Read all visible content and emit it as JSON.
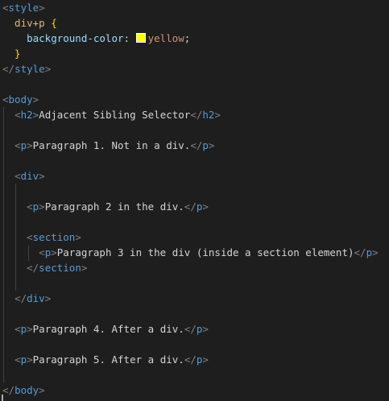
{
  "editor": {
    "theme_colors": {
      "background": "#1e1e1e",
      "tag": "#569cd6",
      "bracket": "#808080",
      "selector": "#d7ba7d",
      "brace": "#ffd700",
      "property": "#9cdcfe",
      "value": "#ce9178",
      "text": "#d4d4d4",
      "swatch": "#ffff00"
    },
    "lines": [
      {
        "tokens": [
          {
            "t": "<",
            "c": "c-punct"
          },
          {
            "t": "style",
            "c": "c-tag"
          },
          {
            "t": ">",
            "c": "c-punct"
          }
        ]
      },
      {
        "tokens": [
          {
            "t": "  div+p ",
            "c": "c-sel"
          },
          {
            "t": "{",
            "c": "c-brace"
          }
        ]
      },
      {
        "tokens": [
          {
            "t": "    background-color",
            "c": "c-prop"
          },
          {
            "t": ": ",
            "c": "c-text"
          },
          {
            "swatch": "#ffff00"
          },
          {
            "t": "yellow",
            "c": "c-val"
          },
          {
            "t": ";",
            "c": "c-text"
          }
        ]
      },
      {
        "tokens": [
          {
            "t": "  }",
            "c": "c-brace"
          }
        ]
      },
      {
        "tokens": [
          {
            "t": "</",
            "c": "c-punct"
          },
          {
            "t": "style",
            "c": "c-tag"
          },
          {
            "t": ">",
            "c": "c-punct"
          }
        ]
      },
      {
        "tokens": []
      },
      {
        "tokens": [
          {
            "t": "<",
            "c": "c-punct"
          },
          {
            "t": "body",
            "c": "c-tag"
          },
          {
            "t": ">",
            "c": "c-punct"
          }
        ]
      },
      {
        "tokens": [
          {
            "t": "  ",
            "c": "c-text"
          },
          {
            "t": "<",
            "c": "c-punct"
          },
          {
            "t": "h2",
            "c": "c-tag"
          },
          {
            "t": ">",
            "c": "c-punct"
          },
          {
            "t": "Adjacent Sibling Selector",
            "c": "c-text"
          },
          {
            "t": "</",
            "c": "c-punct"
          },
          {
            "t": "h2",
            "c": "c-tag"
          },
          {
            "t": ">",
            "c": "c-punct"
          }
        ]
      },
      {
        "tokens": []
      },
      {
        "tokens": [
          {
            "t": "  ",
            "c": "c-text"
          },
          {
            "t": "<",
            "c": "c-punct"
          },
          {
            "t": "p",
            "c": "c-tag"
          },
          {
            "t": ">",
            "c": "c-punct"
          },
          {
            "t": "Paragraph 1. Not in a div.",
            "c": "c-text"
          },
          {
            "t": "</",
            "c": "c-punct"
          },
          {
            "t": "p",
            "c": "c-tag"
          },
          {
            "t": ">",
            "c": "c-punct"
          }
        ]
      },
      {
        "tokens": []
      },
      {
        "tokens": [
          {
            "t": "  ",
            "c": "c-text"
          },
          {
            "t": "<",
            "c": "c-punct"
          },
          {
            "t": "div",
            "c": "c-tag"
          },
          {
            "t": ">",
            "c": "c-punct"
          }
        ]
      },
      {
        "tokens": []
      },
      {
        "tokens": [
          {
            "t": "    ",
            "c": "c-text"
          },
          {
            "t": "<",
            "c": "c-punct"
          },
          {
            "t": "p",
            "c": "c-tag"
          },
          {
            "t": ">",
            "c": "c-punct"
          },
          {
            "t": "Paragraph 2 in the div.",
            "c": "c-text"
          },
          {
            "t": "</",
            "c": "c-punct"
          },
          {
            "t": "p",
            "c": "c-tag"
          },
          {
            "t": ">",
            "c": "c-punct"
          }
        ]
      },
      {
        "tokens": []
      },
      {
        "tokens": [
          {
            "t": "    ",
            "c": "c-text"
          },
          {
            "t": "<",
            "c": "c-punct"
          },
          {
            "t": "section",
            "c": "c-tag"
          },
          {
            "t": ">",
            "c": "c-punct"
          }
        ]
      },
      {
        "tokens": [
          {
            "t": "      ",
            "c": "c-text"
          },
          {
            "t": "<",
            "c": "c-punct"
          },
          {
            "t": "p",
            "c": "c-tag"
          },
          {
            "t": ">",
            "c": "c-punct"
          },
          {
            "t": "Paragraph 3 in the div (inside a section element)",
            "c": "c-text"
          },
          {
            "t": "</",
            "c": "c-punct"
          },
          {
            "t": "p",
            "c": "c-tag"
          },
          {
            "t": ">",
            "c": "c-punct"
          }
        ]
      },
      {
        "tokens": [
          {
            "t": "    ",
            "c": "c-text"
          },
          {
            "t": "</",
            "c": "c-punct"
          },
          {
            "t": "section",
            "c": "c-tag"
          },
          {
            "t": ">",
            "c": "c-punct"
          }
        ]
      },
      {
        "tokens": []
      },
      {
        "tokens": [
          {
            "t": "  ",
            "c": "c-text"
          },
          {
            "t": "</",
            "c": "c-punct"
          },
          {
            "t": "div",
            "c": "c-tag"
          },
          {
            "t": ">",
            "c": "c-punct"
          }
        ]
      },
      {
        "tokens": []
      },
      {
        "tokens": [
          {
            "t": "  ",
            "c": "c-text"
          },
          {
            "t": "<",
            "c": "c-punct"
          },
          {
            "t": "p",
            "c": "c-tag"
          },
          {
            "t": ">",
            "c": "c-punct"
          },
          {
            "t": "Paragraph 4. After a div.",
            "c": "c-text"
          },
          {
            "t": "</",
            "c": "c-punct"
          },
          {
            "t": "p",
            "c": "c-tag"
          },
          {
            "t": ">",
            "c": "c-punct"
          }
        ]
      },
      {
        "tokens": []
      },
      {
        "tokens": [
          {
            "t": "  ",
            "c": "c-text"
          },
          {
            "t": "<",
            "c": "c-punct"
          },
          {
            "t": "p",
            "c": "c-tag"
          },
          {
            "t": ">",
            "c": "c-punct"
          },
          {
            "t": "Paragraph 5. After a div.",
            "c": "c-text"
          },
          {
            "t": "</",
            "c": "c-punct"
          },
          {
            "t": "p",
            "c": "c-tag"
          },
          {
            "t": ">",
            "c": "c-punct"
          }
        ]
      },
      {
        "tokens": []
      },
      {
        "tokens": [
          {
            "t": "</",
            "c": "c-punct"
          },
          {
            "t": "body",
            "c": "c-tag"
          },
          {
            "t": ">",
            "c": "c-punct"
          }
        ]
      }
    ]
  }
}
